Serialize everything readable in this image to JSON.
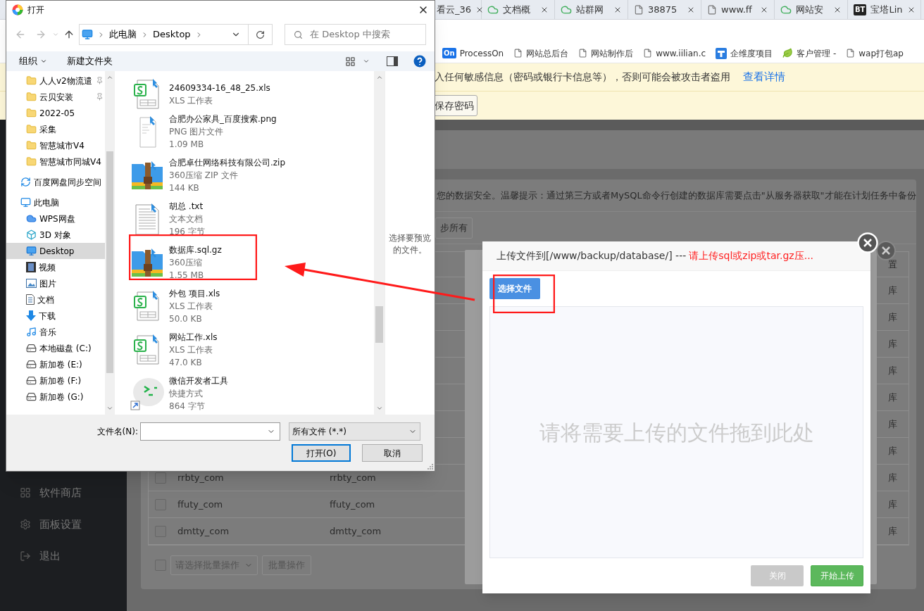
{
  "browser": {
    "tabs": [
      {
        "label": "看云_36",
        "kind": "none"
      },
      {
        "label": "文档概",
        "kind": "cloud"
      },
      {
        "label": "站群网",
        "kind": "cloud"
      },
      {
        "label": "38875",
        "kind": "page"
      },
      {
        "label": "www.ff",
        "kind": "page"
      },
      {
        "label": "网站安",
        "kind": "cloud"
      },
      {
        "label": "宝塔Lin",
        "kind": "badge",
        "badge": "BT"
      }
    ],
    "bookmarks": [
      {
        "label": "ProcessOn",
        "kind": "badge",
        "badge": "On"
      },
      {
        "label": "网站总后台",
        "kind": "page"
      },
      {
        "label": "网站制作后",
        "kind": "page"
      },
      {
        "label": "www.iilian.c",
        "kind": "page"
      },
      {
        "label": "企维度项目",
        "kind": "logo"
      },
      {
        "label": "客户管理 -",
        "kind": "leaf"
      },
      {
        "label": "wap打包ap",
        "kind": "page"
      }
    ],
    "security_bar": {
      "text": "入任何敏感信息（密码或银行卡信息等），否则可能会被攻击者盗用",
      "link": "查看详情"
    },
    "password_bar": {
      "button": "保存密码"
    }
  },
  "panel": {
    "sidebar": [
      {
        "label": "软件商店",
        "kind": "apps"
      },
      {
        "label": "面板设置",
        "kind": "gear"
      },
      {
        "label": "退出",
        "kind": "exit"
      }
    ],
    "tip": "您的数据安全。温馨提示：通过第三方或者MySQL命令行创建的数据库需要点击\"从服务器获取\"才能在计划任务中备份",
    "toolbar_buttons": [
      "步所有"
    ],
    "table": {
      "header_tail": "置",
      "rows": [
        {
          "tail": "库"
        },
        {
          "tail": "库"
        },
        {
          "tail": "库"
        },
        {
          "tail": "库"
        },
        {
          "tail": "库"
        },
        {
          "tail": "库"
        },
        {
          "tail": "库"
        },
        {
          "checked": false,
          "name": "rrbty_com",
          "user": "rrbty_com",
          "tail": "库"
        },
        {
          "checked": false,
          "name": "ffuty_com",
          "user": "ffuty_com",
          "tail": "库"
        },
        {
          "checked": false,
          "name": "dmtty_com",
          "user": "dmtty_com",
          "tail": "库"
        }
      ]
    },
    "batch": {
      "checked": false,
      "placeholder": "请选择批量操作",
      "button": "批量操作"
    }
  },
  "upload_dialog": {
    "title": "上传文件到[/www/backup/database/] --- ",
    "warning": "请上传sql或zip或tar.gz压...",
    "choose_button": "选择文件",
    "drop_hint": "请将需要上传的文件拖到此处",
    "buttons": [
      {
        "label": "关闭",
        "kind": "secondary"
      },
      {
        "label": "开始上传",
        "kind": "primary"
      }
    ]
  },
  "file_dialog": {
    "title": "打开",
    "breadcrumb": [
      "此电脑",
      "Desktop"
    ],
    "search": {
      "placeholder": "在 Desktop 中搜索"
    },
    "toolbar": {
      "organize": "组织",
      "new_folder": "新建文件夹"
    },
    "nav_pane": {
      "quick_access": [
        {
          "label": "人人v2物流遣",
          "pinned": true,
          "selected": false
        },
        {
          "label": "云贝安装",
          "pinned": true,
          "selected": false
        },
        {
          "label": "2022-05",
          "pinned": false,
          "selected": false
        },
        {
          "label": "采集",
          "pinned": false,
          "selected": false
        },
        {
          "label": "智慧城市V4",
          "pinned": false,
          "selected": false
        },
        {
          "label": "智慧城市同城V4",
          "pinned": false,
          "selected": false
        }
      ],
      "items": [
        {
          "label": "百度网盘同步空间",
          "kind": "sync",
          "selected": false
        },
        {
          "label": "此电脑",
          "kind": "pc",
          "selected": false,
          "children": [
            {
              "label": "WPS网盘",
              "kind": "cloud",
              "selected": false
            },
            {
              "label": "3D 对象",
              "kind": "cube",
              "selected": false
            },
            {
              "label": "Desktop",
              "kind": "desktop",
              "selected": true
            },
            {
              "label": "视频",
              "kind": "video",
              "selected": false
            },
            {
              "label": "图片",
              "kind": "picture",
              "selected": false
            },
            {
              "label": "文档",
              "kind": "document",
              "selected": false
            },
            {
              "label": "下载",
              "kind": "download",
              "selected": false
            },
            {
              "label": "音乐",
              "kind": "music",
              "selected": false
            },
            {
              "label": "本地磁盘 (C:)",
              "kind": "disk",
              "selected": false
            },
            {
              "label": "新加卷 (E:)",
              "kind": "disk",
              "selected": false
            },
            {
              "label": "新加卷 (F:)",
              "kind": "disk",
              "selected": false
            },
            {
              "label": "新加卷 (G:)",
              "kind": "disk",
              "selected": false
            }
          ]
        }
      ]
    },
    "files": [
      {
        "name": "24609334-16_48_25.xls",
        "type": "XLS 工作表",
        "kind": "xls"
      },
      {
        "name": "合肥办公家具_百度搜索.png",
        "type": "PNG 图片文件",
        "size": "1.09 MB",
        "kind": "png"
      },
      {
        "name": "合肥卓仕网络科技有限公司.zip",
        "type": "360压缩 ZIP 文件",
        "size": "144 KB",
        "kind": "zip"
      },
      {
        "name": "胡总 .txt",
        "type": "文本文档",
        "size": "196 字节",
        "kind": "txt"
      },
      {
        "name": "数据库.sql.gz",
        "type": "360压缩",
        "size": "1.55 MB",
        "kind": "zip"
      },
      {
        "name": "外包 项目.xls",
        "type": "XLS 工作表",
        "size": "50.0 KB",
        "kind": "xls"
      },
      {
        "name": "网站工作.xls",
        "type": "XLS 工作表",
        "size": "47.0 KB",
        "kind": "xls"
      },
      {
        "name": "微信开发者工具",
        "type": "快捷方式",
        "size": "864 字节",
        "kind": "shortcut"
      }
    ],
    "preview_hint": "选择要预览的文件。",
    "filename_label": "文件名(N):",
    "filter": "所有文件 (*.*)",
    "open_button": "打开(O)",
    "cancel_button": "取消"
  }
}
